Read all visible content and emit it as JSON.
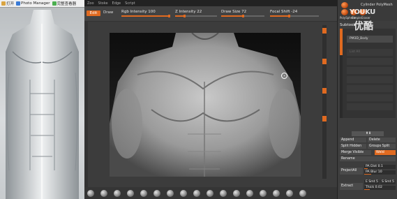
{
  "reference": {
    "toolbar": [
      {
        "label": "打开",
        "icon": "folder-icon",
        "color": "#d9a441"
      },
      {
        "label": "Photo Manager",
        "icon": "photo-manager-icon",
        "color": "#3a7bd5"
      },
      {
        "label": "完整查看器",
        "icon": "viewer-icon",
        "color": "#4caf50"
      }
    ]
  },
  "menubar": [
    "Zoo",
    "Stoke",
    "Edge",
    "Script"
  ],
  "toolbar": {
    "edit_label": "Edit",
    "draw_label": "Draw",
    "rgb_intensity": {
      "label": "Rgb Intensity",
      "value": "100",
      "level": 1.0
    },
    "z_intensity": {
      "label": "Z Intensity",
      "value": "22",
      "level": 0.22
    },
    "draw_size": {
      "label": "Draw Size",
      "value": "72",
      "level": 0.5
    },
    "focal_shift": {
      "label": "Focal Shift",
      "value": "-24",
      "level": 0.38
    }
  },
  "right_panel": {
    "header": "Cylinder PolyMesh",
    "icon_labels": [
      "PolySphere",
      "Simple",
      "Eraser"
    ],
    "subtool_heading": "Subtool",
    "subtool_rows": [
      "PM3D_Body",
      "",
      "",
      "",
      "",
      "",
      "",
      "",
      "",
      "",
      ""
    ],
    "row_labels": {
      "list_all": "List All"
    },
    "buttons": {
      "append": "Append",
      "delete": "Delete",
      "split_hidden": "Split Hidden",
      "groups_split": "Groups Split",
      "merge_visible": "Merge Visible",
      "weld": "Weld",
      "rename": "Rename",
      "project_all": "ProjectAll",
      "extract": "Extract"
    },
    "params": {
      "pa_dist": {
        "label": "PA Dist",
        "value": "0.1"
      },
      "pa_blur": {
        "label": "PA Blur",
        "value": "10"
      },
      "e_smt": {
        "label": "E Smt",
        "value": "5"
      },
      "s_smt": {
        "label": "S Smt",
        "value": "5"
      },
      "thick": {
        "label": "Thick",
        "value": "0.02"
      }
    }
  },
  "watermark": {
    "line1": "YOUKU",
    "line2": "优酷"
  },
  "colors": {
    "accent": "#e06a20",
    "panel": "#3c3c3c",
    "canvas": "#0e0e0e"
  }
}
